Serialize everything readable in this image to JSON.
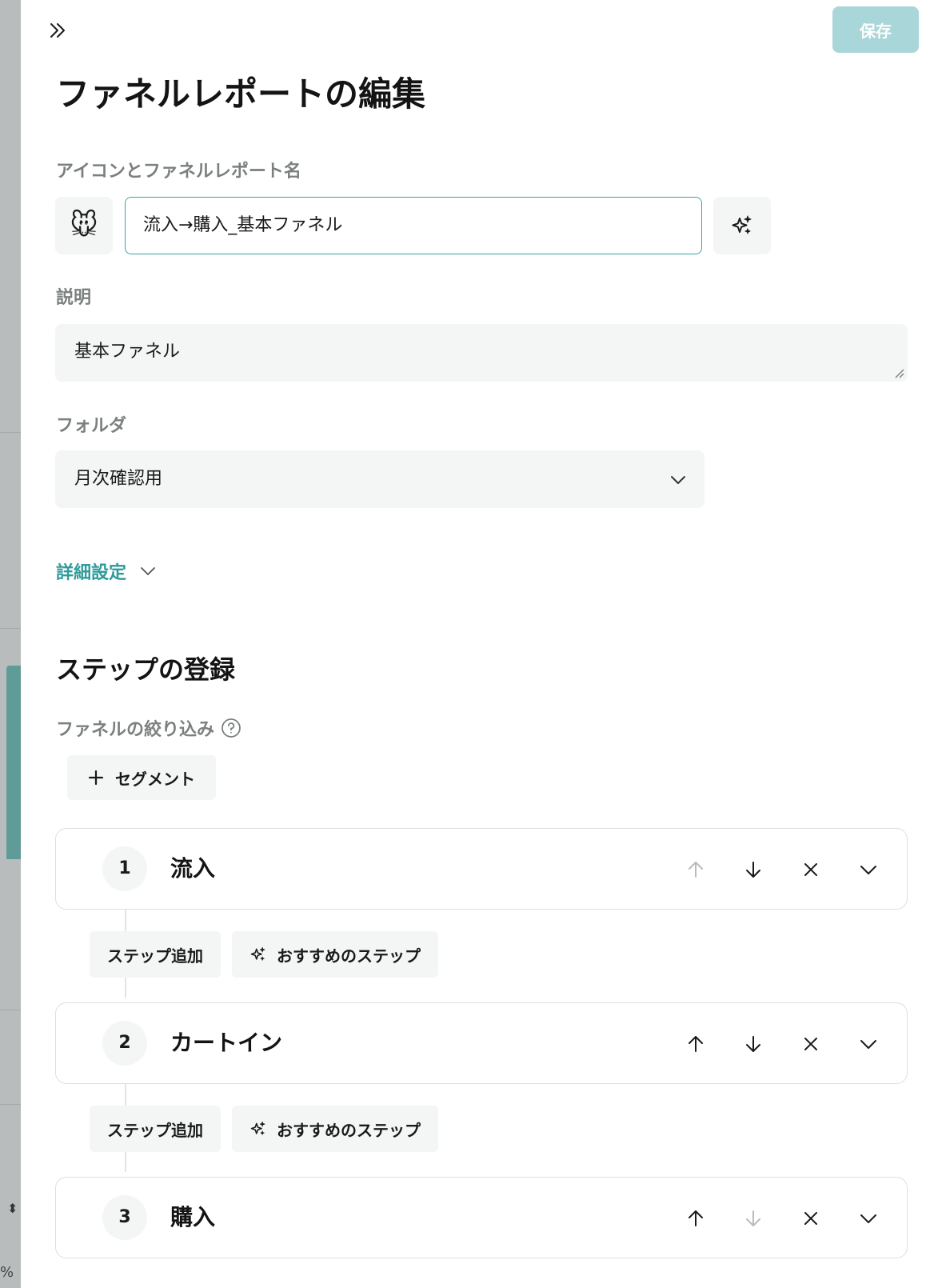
{
  "header": {
    "save_label": "保存",
    "title": "ファネルレポートの編集"
  },
  "form": {
    "name_label": "アイコンとファネルレポート名",
    "icon_emoji": "🐭",
    "name_value": "流入→購入_基本ファネル",
    "description_label": "説明",
    "description_value": "基本ファネル",
    "folder_label": "フォルダ",
    "folder_value": "月次確認用",
    "advanced_label": "詳細設定"
  },
  "steps_section": {
    "title": "ステップの登録",
    "filter_label": "ファネルの絞り込み",
    "segment_button": "セグメント",
    "add_step_label": "ステップ追加",
    "recommended_label": "おすすめのステップ",
    "steps": [
      {
        "number": "1",
        "name": "流入",
        "up_enabled": false,
        "down_enabled": true
      },
      {
        "number": "2",
        "name": "カートイン",
        "up_enabled": true,
        "down_enabled": true
      },
      {
        "number": "3",
        "name": "購入",
        "up_enabled": true,
        "down_enabled": false
      }
    ]
  },
  "backdrop": {
    "percent_glyph": "%"
  },
  "colors": {
    "accent": "#38a6a6",
    "save_disabled": "#a9d6d8",
    "field_bg": "#f4f5f5"
  }
}
